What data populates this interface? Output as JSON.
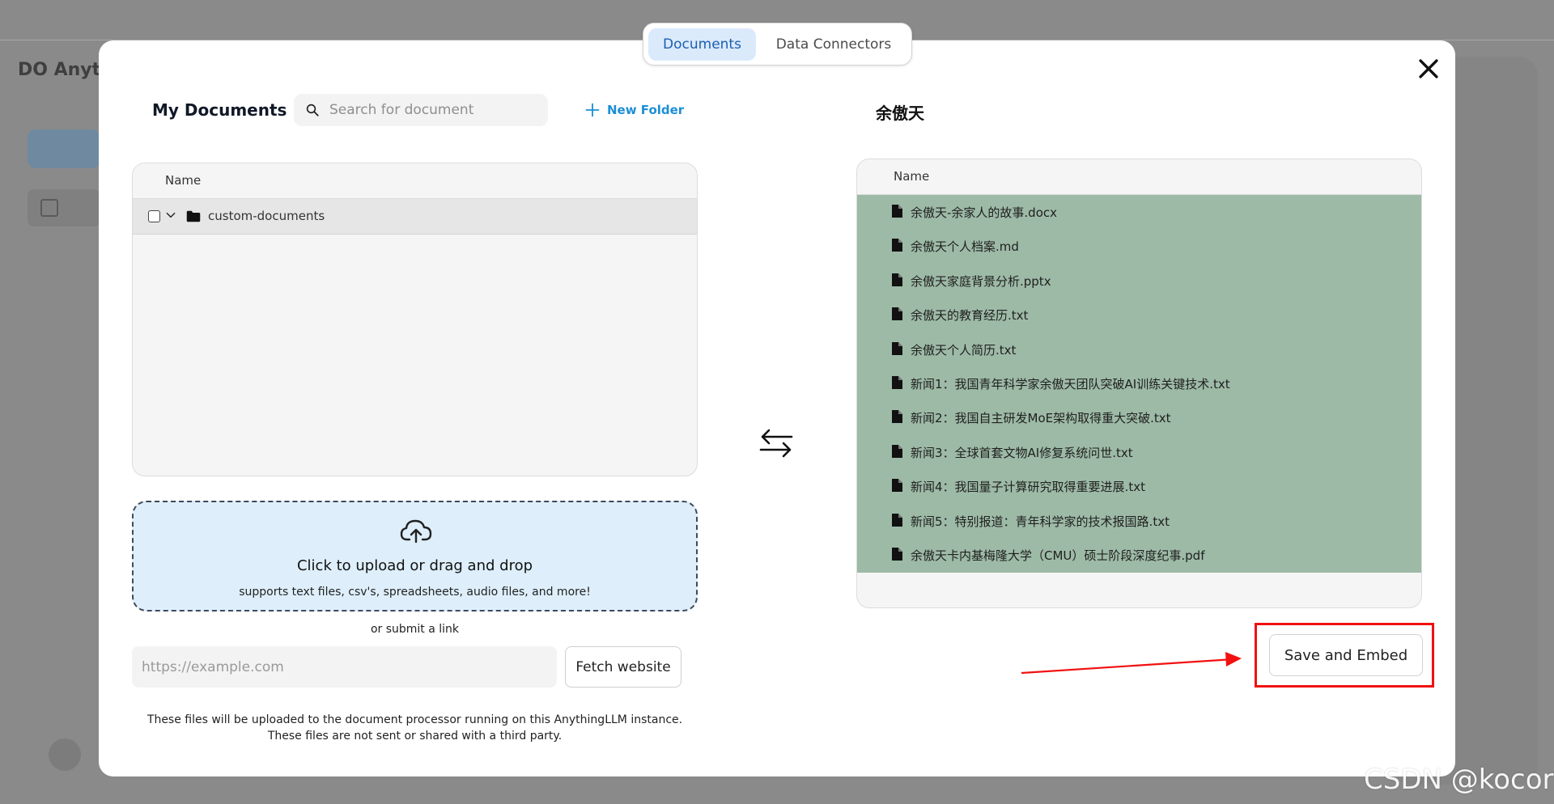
{
  "background": {
    "app_logo_fragment": "AnythingLLM"
  },
  "tabs": {
    "documents": "Documents",
    "data_connectors": "Data Connectors",
    "active": "documents"
  },
  "left_panel": {
    "title": "My Documents",
    "search_placeholder": "Search for document",
    "new_folder_label": "New Folder",
    "table_header": "Name",
    "folders": [
      {
        "name": "custom-documents",
        "checked": false,
        "expanded": true
      }
    ],
    "upload": {
      "title": "Click to upload or drag and drop",
      "subtitle": "supports text files, csv's, spreadsheets, audio files, and more!"
    },
    "or_submit_link": "or submit a link",
    "url_placeholder": "https://example.com",
    "fetch_button": "Fetch website",
    "footnote_line1": "These files will be uploaded to the document processor running on this AnythingLLM instance.",
    "footnote_line2": "These files are not sent or shared with a third party."
  },
  "right_panel": {
    "workspace_name": "余傲天",
    "table_header": "Name",
    "files": [
      "余傲天-余家人的故事.docx",
      "余傲天个人档案.md",
      "余傲天家庭背景分析.pptx",
      "余傲天的教育经历.txt",
      "余傲天个人简历.txt",
      "新闻1：我国青年科学家余傲天团队突破AI训练关键技术.txt",
      "新闻2：我国自主研发MoE架构取得重大突破.txt",
      "新闻3：全球首套文物AI修复系统问世.txt",
      "新闻4：我国量子计算研究取得重要进展.txt",
      "新闻5：特别报道：青年科学家的技术报国路.txt",
      "余傲天卡内基梅隆大学（CMU）硕士阶段深度纪事.pdf"
    ],
    "save_button": "Save and Embed"
  },
  "colors": {
    "active_tab_bg": "#dbeafb",
    "accent_blue": "#1d8fd6",
    "workspace_list_bg": "#9dbaa6",
    "annotation_red": "#f21010"
  },
  "icons": {
    "close": "close-icon",
    "search": "search-icon",
    "new_folder": "plus-icon",
    "upload": "cloud-upload-icon",
    "swap": "swap-arrows-icon",
    "file": "file-icon",
    "folder": "folder-icon"
  },
  "watermark": "CSDN @kocor"
}
